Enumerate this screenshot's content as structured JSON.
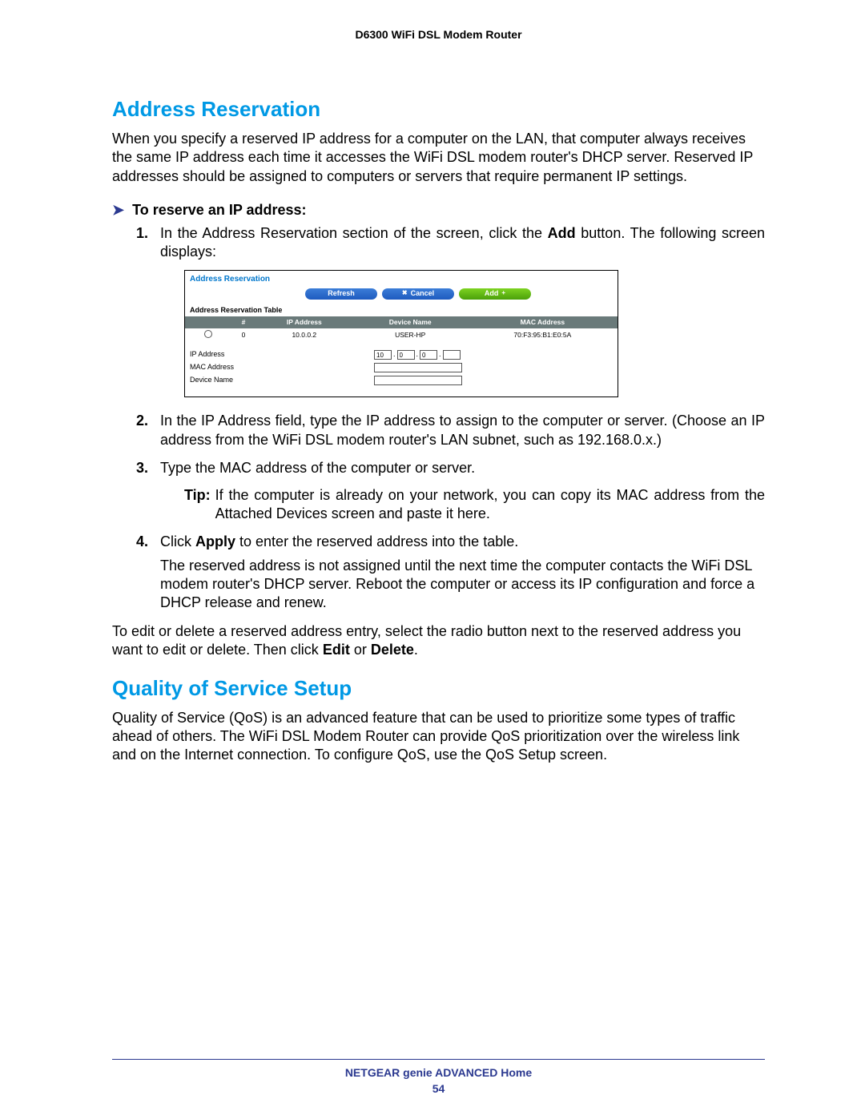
{
  "header": {
    "product": "D6300 WiFi DSL Modem Router"
  },
  "section1": {
    "heading": "Address Reservation",
    "intro": "When you specify a reserved IP address for a computer on the LAN, that computer always receives the same IP address each time it accesses the WiFi DSL modem router's DHCP server. Reserved IP addresses should be assigned to computers or servers that require permanent IP settings."
  },
  "procedure": {
    "title": "To reserve an IP address:",
    "steps": [
      {
        "pre": "In the Address Reservation section of the screen, click the ",
        "bold1": "Add",
        "post": " button. The following screen displays:"
      },
      {
        "text": "In the IP Address field, type the IP address to assign to the computer or server. (Choose an IP address from the WiFi DSL modem router's LAN subnet, such as 192.168.0.x.)"
      },
      {
        "text": "Type the MAC address of the computer or server."
      },
      {
        "pre": "Click ",
        "bold1": "Apply",
        "post": " to enter the reserved address into the table.",
        "after": "The reserved address is not assigned until the next time the computer contacts the WiFi DSL modem router's DHCP server. Reboot the computer or access its IP configuration and force a DHCP release and renew."
      }
    ],
    "tip_label": "Tip:",
    "tip_text": "If the computer is already on your network, you can copy its MAC address from the Attached Devices screen and paste it here."
  },
  "screenshot": {
    "title": "Address Reservation",
    "buttons": {
      "refresh": "Refresh",
      "cancel": "Cancel",
      "add": "Add"
    },
    "table_label": "Address Reservation Table",
    "headers": [
      "#",
      "IP Address",
      "Device Name",
      "MAC Address"
    ],
    "row": {
      "num": "0",
      "ip": "10.0.0.2",
      "name": "USER-HP",
      "mac": "70:F3:95:B1:E0:5A"
    },
    "form": {
      "ip_label": "IP Address",
      "mac_label": "MAC Address",
      "device_label": "Device Name",
      "ip_vals": [
        "10",
        "0",
        "0",
        ""
      ]
    }
  },
  "edit_para": {
    "pre": "To edit or delete a reserved address entry, select the radio button next to the reserved address you want to edit or delete. Then click ",
    "b1": "Edit",
    "mid": " or ",
    "b2": "Delete",
    "post": "."
  },
  "section2": {
    "heading": "Quality of Service Setup",
    "intro": "Quality of Service (QoS) is an advanced feature that can be used to prioritize some types of traffic ahead of others. The WiFi DSL Modem Router can provide QoS prioritization over the wireless link and on the Internet connection. To configure QoS, use the QoS Setup screen."
  },
  "footer": {
    "text": "NETGEAR genie ADVANCED Home",
    "page": "54"
  }
}
